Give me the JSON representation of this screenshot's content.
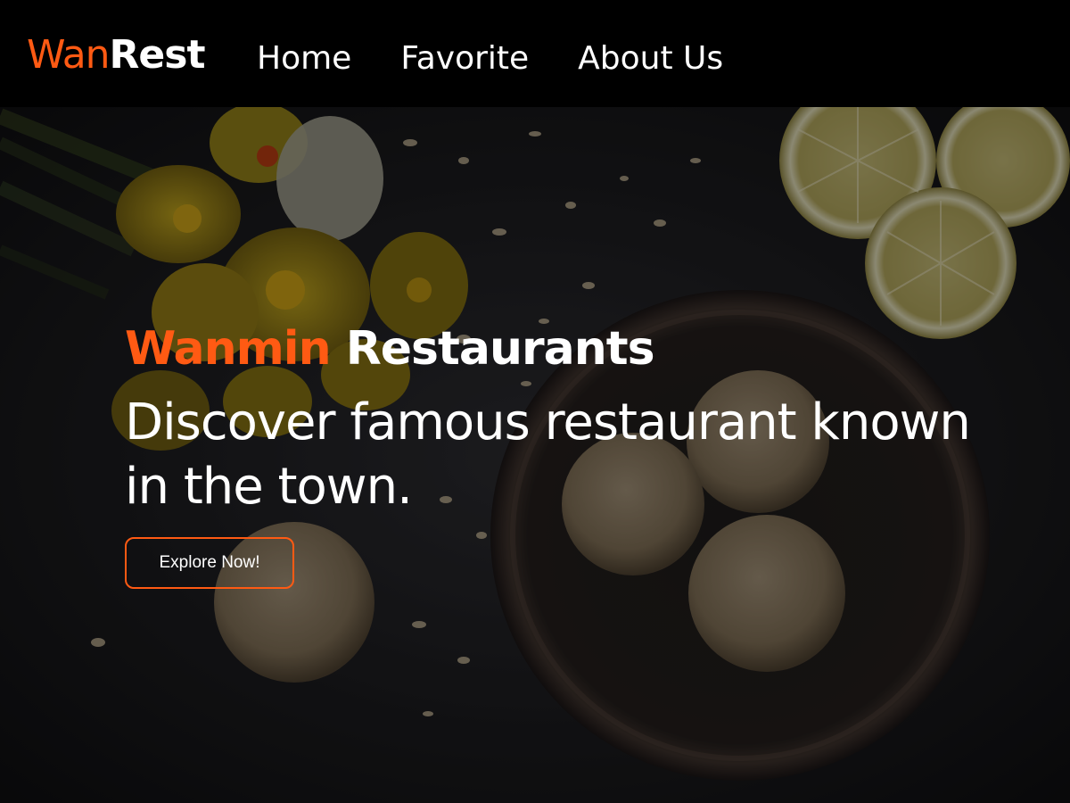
{
  "navbar": {
    "brand_accent": "Wan",
    "brand_rest": "Rest",
    "links": [
      {
        "label": "Home"
      },
      {
        "label": "Favorite"
      },
      {
        "label": "About Us"
      }
    ]
  },
  "hero": {
    "title_accent": "Wanmin",
    "title_rest": "Restaurants",
    "subtitle": "Discover famous restaurant known in the town.",
    "cta_label": "Explore Now!",
    "background_image": "food-photo-cookies-bowl-lemons-flowers"
  },
  "colors": {
    "accent": "#ff5a13",
    "navbar_bg": "#000000",
    "text": "#ffffff"
  }
}
